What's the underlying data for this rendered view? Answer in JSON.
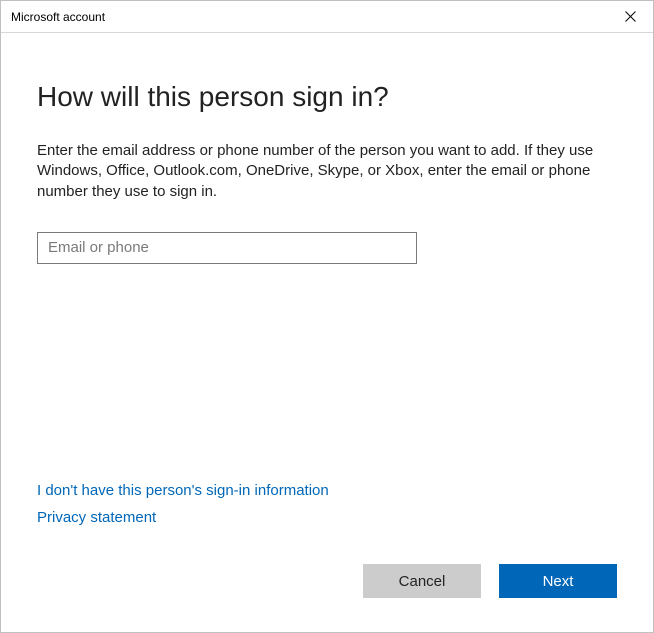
{
  "titlebar": {
    "title": "Microsoft account"
  },
  "main": {
    "heading": "How will this person sign in?",
    "description": "Enter the email address or phone number of the person you want to add. If they use Windows, Office, Outlook.com, OneDrive, Skype, or Xbox, enter the email or phone number they use to sign in.",
    "input_placeholder": "Email or phone",
    "input_value": ""
  },
  "links": {
    "no_info": "I don't have this person's sign-in information",
    "privacy": "Privacy statement"
  },
  "buttons": {
    "cancel": "Cancel",
    "next": "Next"
  }
}
